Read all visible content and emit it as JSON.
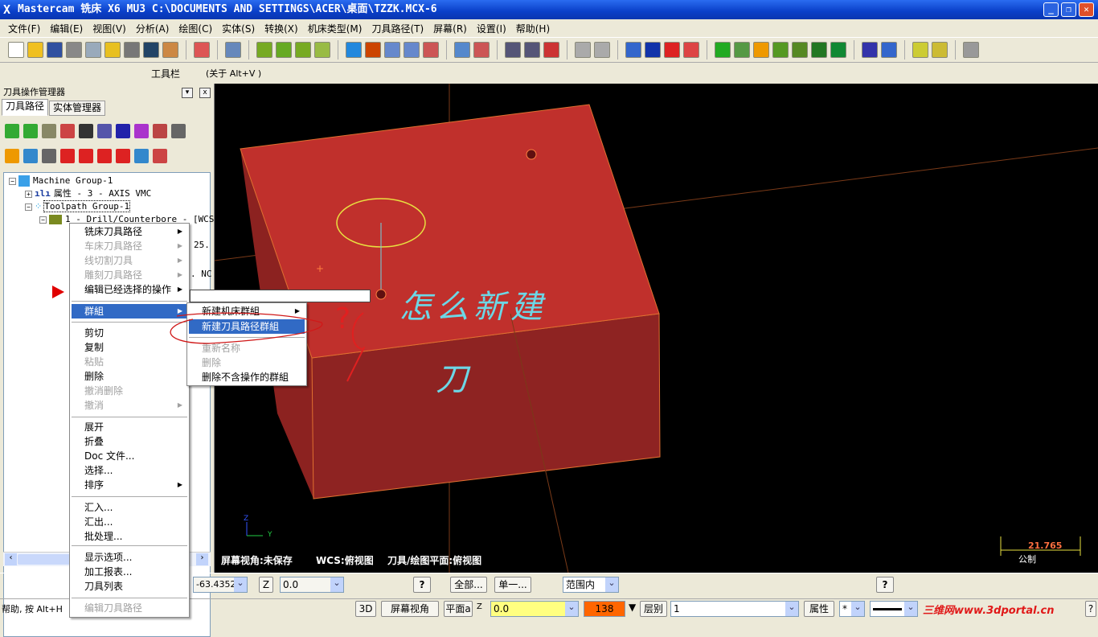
{
  "window": {
    "title": "Mastercam 铣床 X6 MU3  C:\\DOCUMENTS AND SETTINGS\\ACER\\桌面\\TZZK.MCX-6",
    "min": "_",
    "max": "❐",
    "close": "✕"
  },
  "menubar": [
    "文件(F)",
    "编辑(E)",
    "视图(V)",
    "分析(A)",
    "绘图(C)",
    "实体(S)",
    "转换(X)",
    "机床类型(M)",
    "刀具路径(T)",
    "屏幕(R)",
    "设置(I)",
    "帮助(H)"
  ],
  "toolbar_label": {
    "name": "工具栏",
    "hint": "(关于 Alt+V )"
  },
  "panel": {
    "title": "刀具操作管理器",
    "tabs": [
      "刀具路径",
      "实体管理器"
    ],
    "tree": [
      {
        "label": "Machine Group-1",
        "icon": "machine-group-icon"
      },
      {
        "label": "属性 - 3 - AXIS VMC",
        "icon": "properties-icon"
      },
      {
        "label": "Toolpath Group-1",
        "icon": "toolpath-group-icon"
      },
      {
        "label": "1 - Drill/Counterbore - [WCS:",
        "icon": "operation-folder-icon"
      },
      {
        "label": "25."
      },
      {
        "label": ". NC"
      }
    ]
  },
  "context_menu": {
    "items": [
      {
        "label": "铣床刀具路径",
        "disabled": false,
        "submenu": true
      },
      {
        "label": "车床刀具路径",
        "disabled": true,
        "submenu": true
      },
      {
        "label": "线切割刀具",
        "disabled": true,
        "submenu": true
      },
      {
        "label": "雕刻刀具路径",
        "disabled": true,
        "submenu": true
      },
      {
        "label": "编辑已经选择的操作",
        "disabled": false,
        "submenu": true
      },
      {
        "label": "群組",
        "disabled": false,
        "submenu": true,
        "highlighted": true
      },
      {
        "label": "剪切",
        "disabled": false
      },
      {
        "label": "复制",
        "disabled": false
      },
      {
        "label": "粘贴",
        "disabled": true
      },
      {
        "label": "删除",
        "disabled": false
      },
      {
        "label": "撤消删除",
        "disabled": true
      },
      {
        "label": "撤消",
        "disabled": true,
        "submenu": true
      },
      {
        "label": "展开",
        "disabled": false
      },
      {
        "label": "折叠",
        "disabled": false
      },
      {
        "label": "Doc 文件...",
        "disabled": false
      },
      {
        "label": "选择...",
        "disabled": false
      },
      {
        "label": "排序",
        "disabled": false,
        "submenu": true
      },
      {
        "label": "汇入...",
        "disabled": false
      },
      {
        "label": "汇出...",
        "disabled": false
      },
      {
        "label": "批处理...",
        "disabled": false
      },
      {
        "label": "显示选项...",
        "disabled": false
      },
      {
        "label": "加工报表...",
        "disabled": false
      },
      {
        "label": "刀具列表",
        "disabled": false
      },
      {
        "label": "编辑刀具路径",
        "disabled": true
      }
    ]
  },
  "submenu": {
    "items": [
      {
        "label": "新建机床群組",
        "disabled": false,
        "submenu": true
      },
      {
        "label": "新建刀具路径群組",
        "disabled": false,
        "highlighted": true
      },
      {
        "label": "重新名称",
        "disabled": true
      },
      {
        "label": "删除",
        "disabled": true
      },
      {
        "label": "删除不含操作的群組",
        "disabled": false
      }
    ]
  },
  "viewport": {
    "screen_view": "屏幕视角:未保存",
    "wcs": "WCS:俯视图",
    "plane": "刀具/绘图平面:俯视图",
    "scale_value": "21.765",
    "scale_unit": "公制",
    "axis_z": "Z",
    "axis_y": "Y",
    "annotation": "怎么新建",
    "annotation2": "刀",
    "annotation_mark": "?"
  },
  "bottombar": {
    "coord": "-63.4352",
    "z_label": "Z",
    "z_value": "0.0",
    "all": "全部...",
    "single": "单一...",
    "range": "范围内"
  },
  "statusbar": {
    "help": "帮助, 按 Alt+H",
    "mode3d": "3D",
    "screen_view": "屏幕视角",
    "plane": "平面a",
    "z_label": "Z",
    "z_value": "0.0",
    "color": "138",
    "level_label": "层别",
    "level": "1",
    "attr": "属性",
    "style": "*",
    "watermark": "三维网www.3dportal.cn",
    "q": "?"
  },
  "colors": {
    "part": "#c0302c",
    "highlight": "#316ac5",
    "viewport": "#000000",
    "color_swatch": "#ff6600"
  }
}
